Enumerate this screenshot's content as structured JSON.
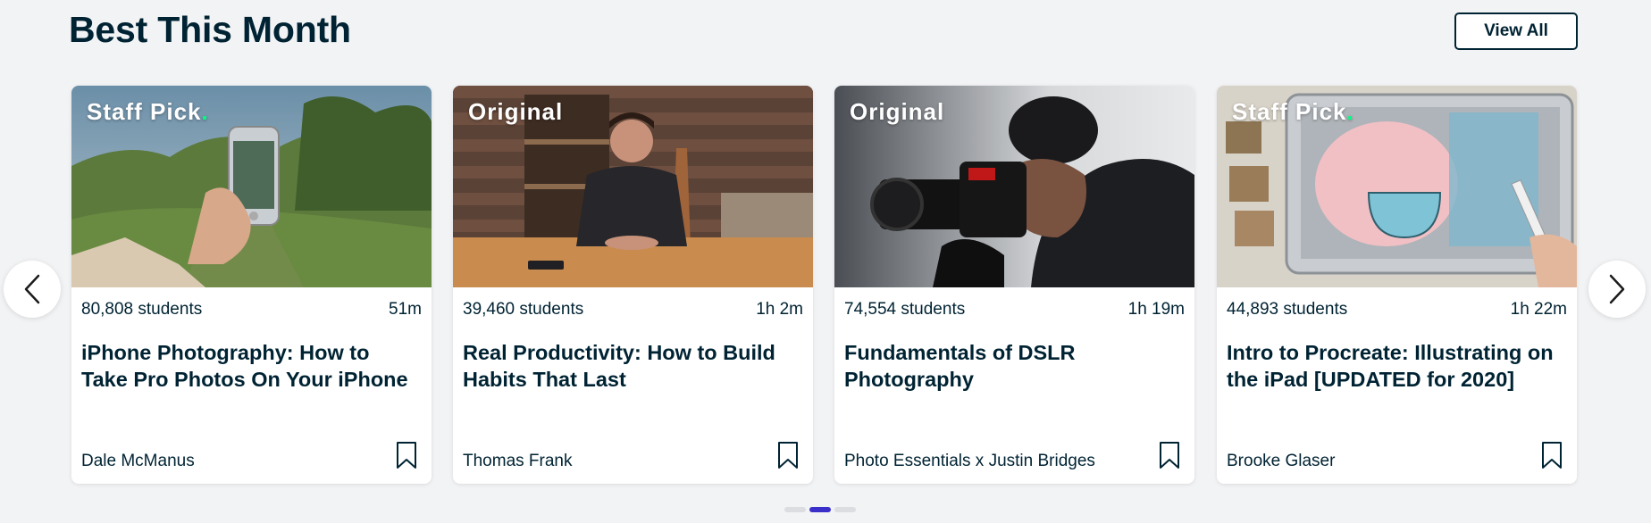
{
  "section": {
    "title": "Best This Month",
    "view_all_label": "View All"
  },
  "cards": [
    {
      "badge": "Staff Pick",
      "badge_dot": ".",
      "students": "80,808 students",
      "duration": "51m",
      "title": "iPhone Photography: How to Take Pro Photos On Your iPhone",
      "teacher": "Dale McManus"
    },
    {
      "badge": "Original",
      "badge_dot": "",
      "students": "39,460 students",
      "duration": "1h 2m",
      "title": "Real Productivity: How to Build Habits That Last",
      "teacher": "Thomas Frank"
    },
    {
      "badge": "Original",
      "badge_dot": "",
      "students": "74,554 students",
      "duration": "1h 19m",
      "title": "Fundamentals of DSLR Photography",
      "teacher": "Photo Essentials x Justin Bridges"
    },
    {
      "badge": "Staff Pick",
      "badge_dot": ".",
      "students": "44,893 students",
      "duration": "1h 22m",
      "title": "Intro to Procreate: Illustrating on the iPad [UPDATED for 2020]",
      "teacher": "Brooke Glaser"
    }
  ],
  "carousel": {
    "prev_icon": "chevron-left-icon",
    "next_icon": "chevron-right-icon",
    "page_count": 3,
    "active_page": 2
  },
  "colors": {
    "text": "#002333",
    "badge_dot": "#00ff84",
    "active_dot": "#3b2fc9"
  }
}
